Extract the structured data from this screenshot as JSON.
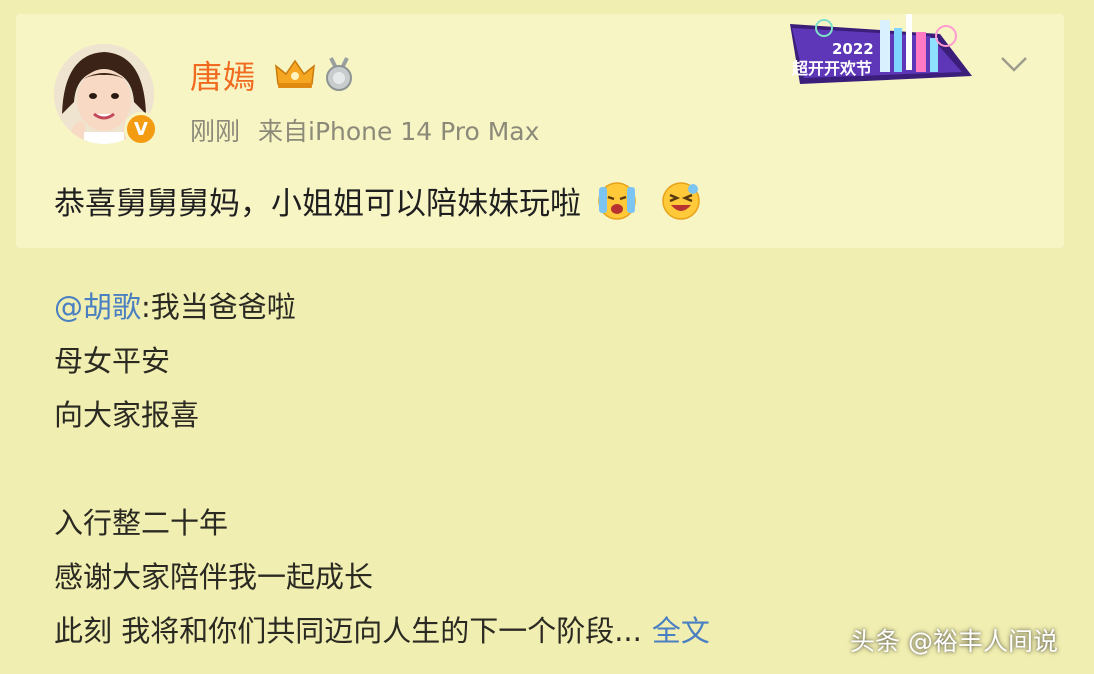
{
  "post": {
    "author": "唐嫣",
    "time": "刚刚",
    "source": "来自iPhone 14 Pro Max",
    "content": "恭喜舅舅舅妈，小姐姐可以陪妹妹玩啦",
    "festival_badge_year": "2022",
    "festival_badge_text": "超开开欢节"
  },
  "repost": {
    "mention": "@胡歌",
    "first_line_rest": ":我当爸爸啦",
    "lines": [
      "母女平安",
      "向大家报喜",
      "入行整二十年",
      "感谢大家陪伴我一起成长"
    ],
    "last_line": "此刻 我将和你们共同迈向人生的下一个阶段...",
    "more_label": "全文"
  },
  "watermark": "头条 @裕丰人间说",
  "colors": {
    "background": "#f1eeb1",
    "card": "#f8f5c5",
    "name": "#f06a1f",
    "link": "#4a7fc1",
    "meta": "#8b8a79"
  },
  "icons": [
    "crown-icon",
    "medal-icon",
    "festival-icon",
    "chevron-down-icon",
    "verified-badge-icon",
    "crying-emoji-icon",
    "laughing-emoji-icon"
  ]
}
